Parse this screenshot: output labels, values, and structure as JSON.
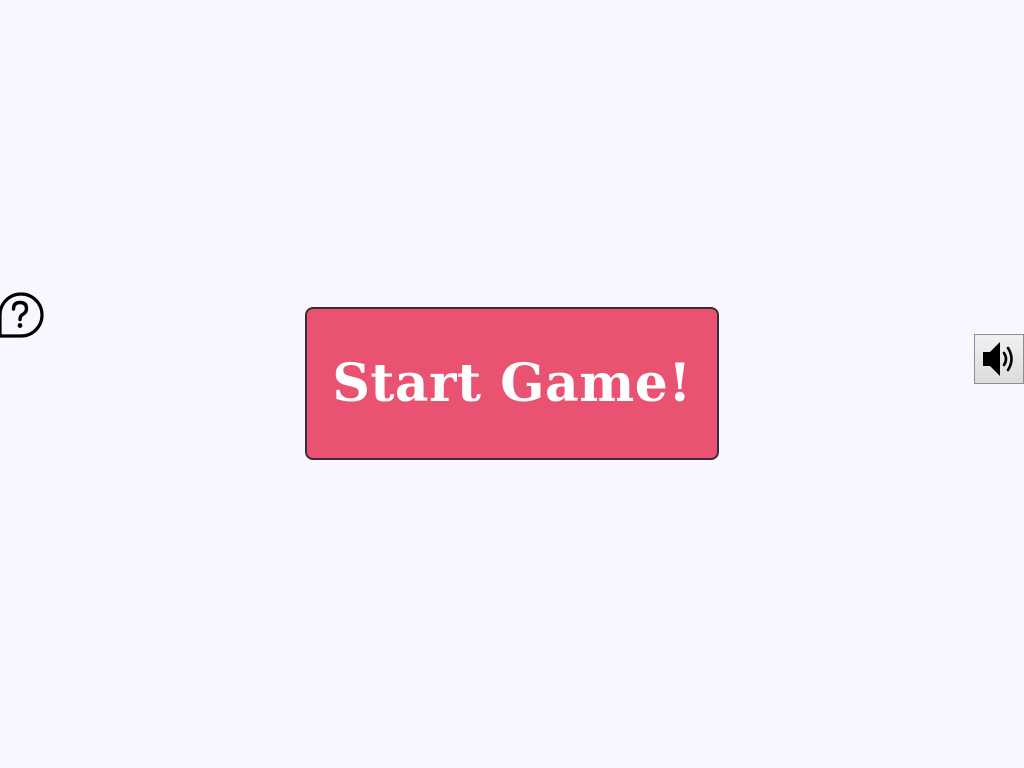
{
  "help": {
    "icon": "question-bubble-icon"
  },
  "start_button": {
    "label": "Start Game!"
  },
  "sound_button": {
    "icon": "speaker-volume-icon"
  },
  "colors": {
    "background": "#f7f8ff",
    "start_button_fill": "#ea5272",
    "start_button_border": "#3b2a3a",
    "start_button_text": "#ffffff"
  }
}
